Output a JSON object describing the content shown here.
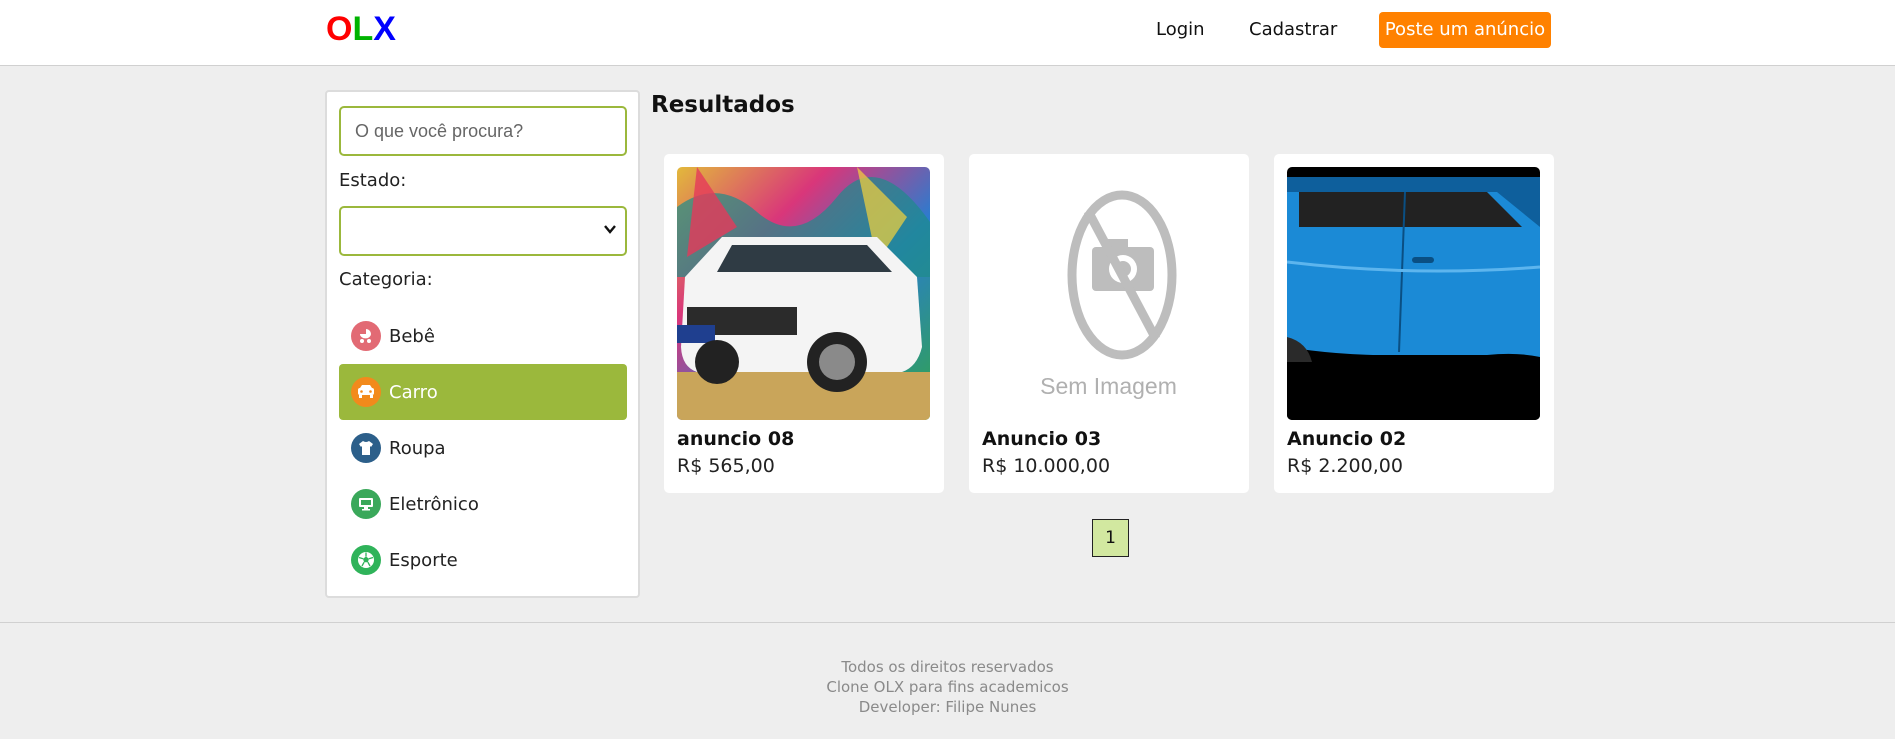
{
  "header": {
    "logo": [
      "O",
      "L",
      "X"
    ],
    "login_label": "Login",
    "register_label": "Cadastrar",
    "post_ad_label": "Poste um anúncio"
  },
  "sidebar": {
    "search_placeholder": "O que você procura?",
    "search_value": "",
    "state_label": "Estado:",
    "state_value": "",
    "category_label": "Categoria:",
    "categories": [
      {
        "label": "Bebê",
        "icon": "baby-carriage-icon",
        "color": "#e26a74",
        "active": false
      },
      {
        "label": "Carro",
        "icon": "car-icon",
        "color": "#f28a1c",
        "active": true
      },
      {
        "label": "Roupa",
        "icon": "shirt-icon",
        "color": "#2c5f8a",
        "active": false
      },
      {
        "label": "Eletrônico",
        "icon": "monitor-icon",
        "color": "#3aa85a",
        "active": false
      },
      {
        "label": "Esporte",
        "icon": "soccer-ball-icon",
        "color": "#2fb35a",
        "active": false
      }
    ]
  },
  "results": {
    "title": "Resultados",
    "items": [
      {
        "title": "anuncio 08",
        "price": "R$ 565,00"
      },
      {
        "title": "Anuncio 03",
        "price": "R$ 10.000,00",
        "no_image_text": "Sem Imagem"
      },
      {
        "title": "Anuncio 02",
        "price": "R$ 2.200,00"
      }
    ],
    "pagination": {
      "pages": [
        "1"
      ],
      "current": "1"
    }
  },
  "footer": {
    "lines": [
      "Todos os direitos reservados",
      "Clone OLX para fins academicos",
      "Developer: Filipe Nunes"
    ]
  },
  "colors": {
    "accent_green": "#9bb83c",
    "post_button": "#ff8100",
    "background": "#eeeeee"
  }
}
